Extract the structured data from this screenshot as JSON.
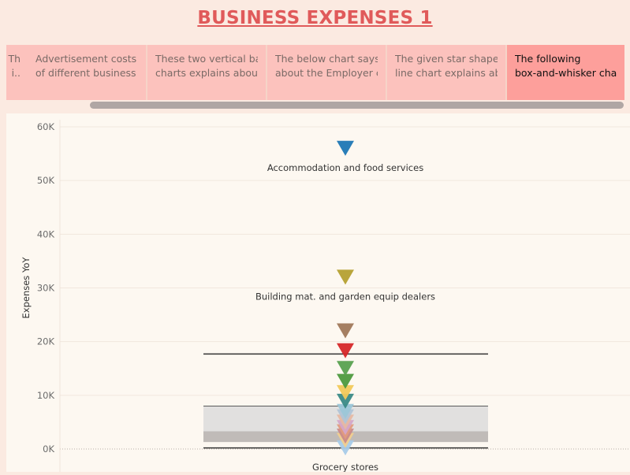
{
  "page": {
    "title": "BUSINESS EXPENSES 1"
  },
  "tabs": [
    {
      "line1": "Th",
      "line2": "i.."
    },
    {
      "line1": "Advertisement costs",
      "line2": "of different business .."
    },
    {
      "line1": "These two vertical bar",
      "line2": "charts explains about.."
    },
    {
      "line1": "The below chart says",
      "line2": "about the Employer c.."
    },
    {
      "line1": "The given star shaped",
      "line2": "line chart explains ab.."
    },
    {
      "line1": "The following",
      "line2": "box-and-whisker char.."
    }
  ],
  "active_tab": 5,
  "chart_data": {
    "type": "box-and-whisker",
    "ylabel": "Expenses YoY",
    "ylim": [
      0,
      60000
    ],
    "yticks": [
      0,
      10000,
      20000,
      30000,
      40000,
      50000,
      60000
    ],
    "ytick_labels": [
      "0K",
      "10K",
      "20K",
      "30K",
      "40K",
      "50K",
      "60K"
    ],
    "grid": true,
    "box": {
      "whisker_low": 200,
      "q1": 1300,
      "median": 3300,
      "q3": 8000,
      "whisker_high": 17700
    },
    "points": [
      {
        "label": "Accommodation and food services",
        "value": 56000,
        "color": "#1f77b4"
      },
      {
        "label": "Building mat. and garden equip dealers",
        "value": 32000,
        "color": "#b5a030"
      },
      {
        "label": "",
        "value": 22000,
        "color": "#a0785a"
      },
      {
        "label": "",
        "value": 18300,
        "color": "#d62728"
      },
      {
        "label": "",
        "value": 15000,
        "color": "#59a14f"
      },
      {
        "label": "",
        "value": 12600,
        "color": "#4e9a3e"
      },
      {
        "label": "",
        "value": 10500,
        "color": "#f2c95a"
      },
      {
        "label": "",
        "value": 8900,
        "color": "#3a8a86"
      },
      {
        "label": "",
        "value": 7000,
        "color": "#9cc7d8"
      },
      {
        "label": "",
        "value": 6000,
        "color": "#b0c4d6"
      },
      {
        "label": "",
        "value": 5000,
        "color": "#e6b8a2"
      },
      {
        "label": "",
        "value": 4000,
        "color": "#d4a6c8"
      },
      {
        "label": "",
        "value": 3200,
        "color": "#e29b7e"
      },
      {
        "label": "",
        "value": 2400,
        "color": "#c98a8a"
      },
      {
        "label": "",
        "value": 1600,
        "color": "#f1ce8e"
      },
      {
        "label": "Grocery stores",
        "value": 200,
        "color": "#a8cbe8"
      }
    ]
  }
}
